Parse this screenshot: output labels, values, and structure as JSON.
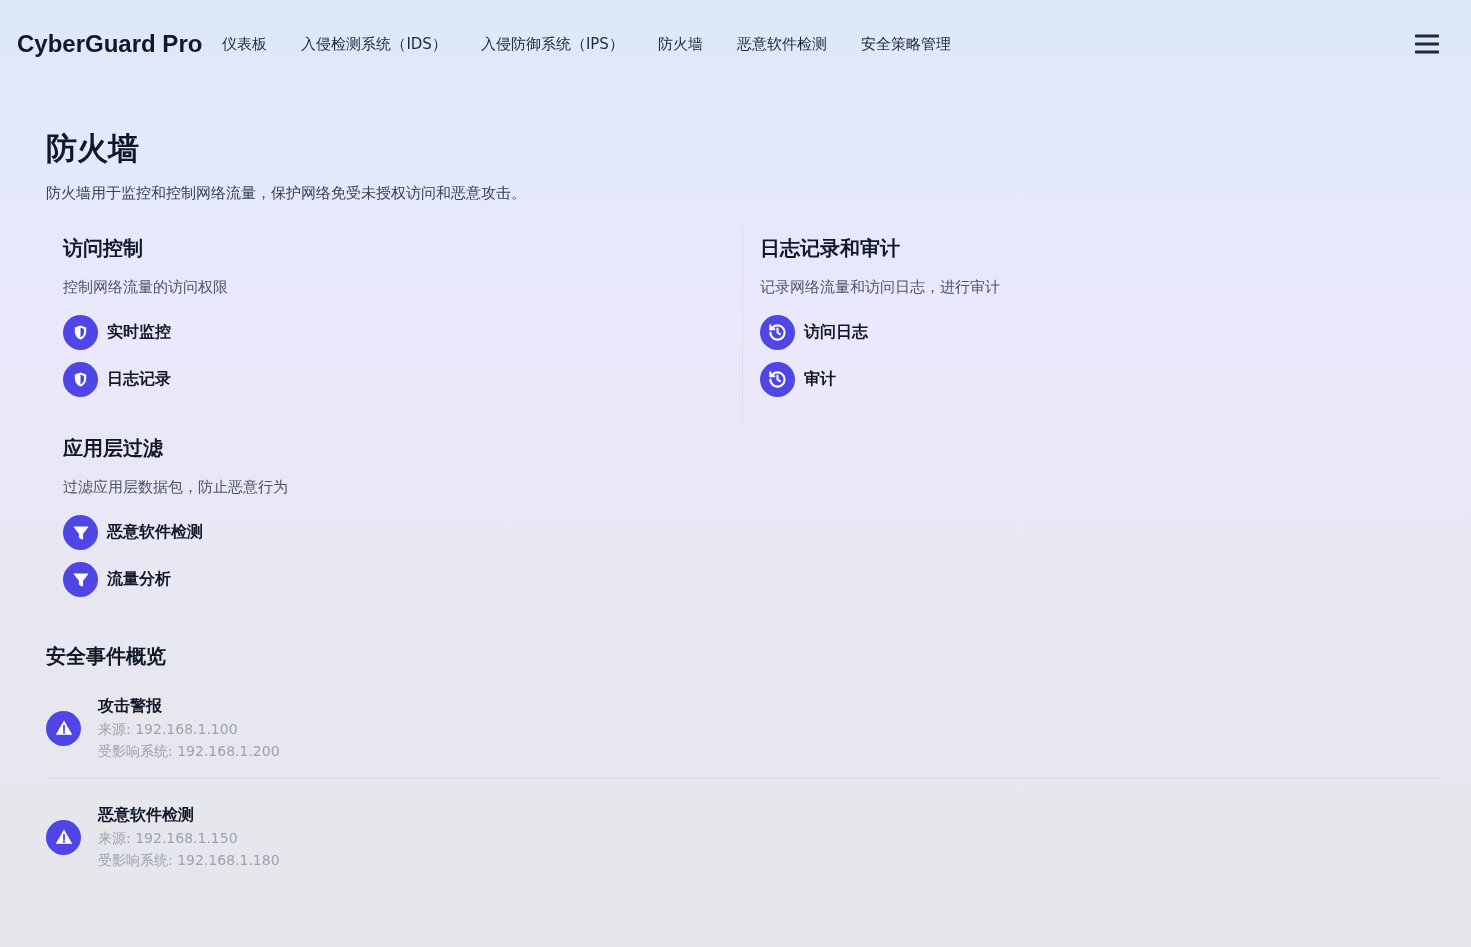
{
  "header": {
    "brand": "CyberGuard Pro",
    "nav": [
      "仪表板",
      "入侵检测系统（IDS）",
      "入侵防御系统（IPS）",
      "防火墙",
      "恶意软件检测",
      "安全策略管理"
    ]
  },
  "page": {
    "title": "防火墙",
    "description": "防火墙用于监控和控制网络流量，保护网络免受未授权访问和恶意攻击。"
  },
  "sections": [
    {
      "title": "访问控制",
      "description": "控制网络流量的访问权限",
      "kind": "shield",
      "items": [
        "实时监控",
        "日志记录"
      ]
    },
    {
      "title": "日志记录和审计",
      "description": "记录网络流量和访问日志，进行审计",
      "kind": "history",
      "items": [
        "访问日志",
        "审计"
      ]
    },
    {
      "title": "应用层过滤",
      "description": "过滤应用层数据包，防止恶意行为",
      "kind": "filter",
      "items": [
        "恶意软件检测",
        "流量分析"
      ]
    }
  ],
  "events": {
    "title": "安全事件概览",
    "items": [
      {
        "title": "攻击警报",
        "source": "来源: 192.168.1.100",
        "affected": "受影响系统: 192.168.1.200"
      },
      {
        "title": "恶意软件检测",
        "source": "来源: 192.168.1.150",
        "affected": "受影响系统: 192.168.1.180"
      }
    ]
  }
}
